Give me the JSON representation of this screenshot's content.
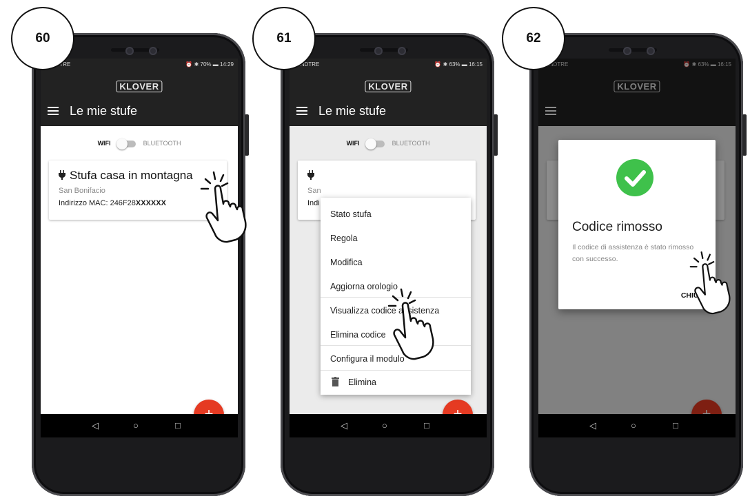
{
  "steps": [
    {
      "number": "60"
    },
    {
      "number": "61"
    },
    {
      "number": "62"
    }
  ],
  "status_bar": [
    {
      "left": "WINDTRE",
      "right": "⏰ ✱ 70% ▬ 14:29"
    },
    {
      "left": "WINDTRE",
      "right": "⏰ ✱ 63% ▬ 16:15"
    },
    {
      "left": "WINDTRE",
      "right": "⏰ ✱ 63% ▬ 16:15"
    }
  ],
  "app": {
    "logo": "KLOVER",
    "title": "Le mie stufe",
    "toggle_left": "WIFI",
    "toggle_right": "BLUETOOTH"
  },
  "stove_card": {
    "name": "Stufa casa in montagna",
    "city": "San Bonifacio",
    "mac_label": "Indirizzo MAC: 246F28",
    "mac_masked": "XXXXXX",
    "partial_city": "San",
    "partial_mac": "Indi"
  },
  "context_menu": {
    "items": [
      "Stato stufa",
      "Regola",
      "Modifica",
      "Aggiorna orologio",
      "Visualizza codice assistenza",
      "Elimina codice",
      "Configura il modulo",
      "Elimina"
    ]
  },
  "dialog": {
    "title": "Codice rimosso",
    "message": "Il codice di assistenza è stato rimosso con successo.",
    "button": "CHIUDI"
  },
  "fab_label": "+",
  "nav": {
    "back": "◁",
    "home": "○",
    "recent": "□"
  },
  "colors": {
    "accent": "#e53a22",
    "success": "#3fc14b",
    "appbar": "#222222",
    "dim_overlay": "rgba(0,0,0,0.45)"
  },
  "icons": [
    "menu-icon",
    "plug-icon",
    "plus-icon",
    "trash-icon",
    "check-icon",
    "hand-pointer-icon",
    "back-nav-icon",
    "home-nav-icon",
    "recent-nav-icon"
  ]
}
